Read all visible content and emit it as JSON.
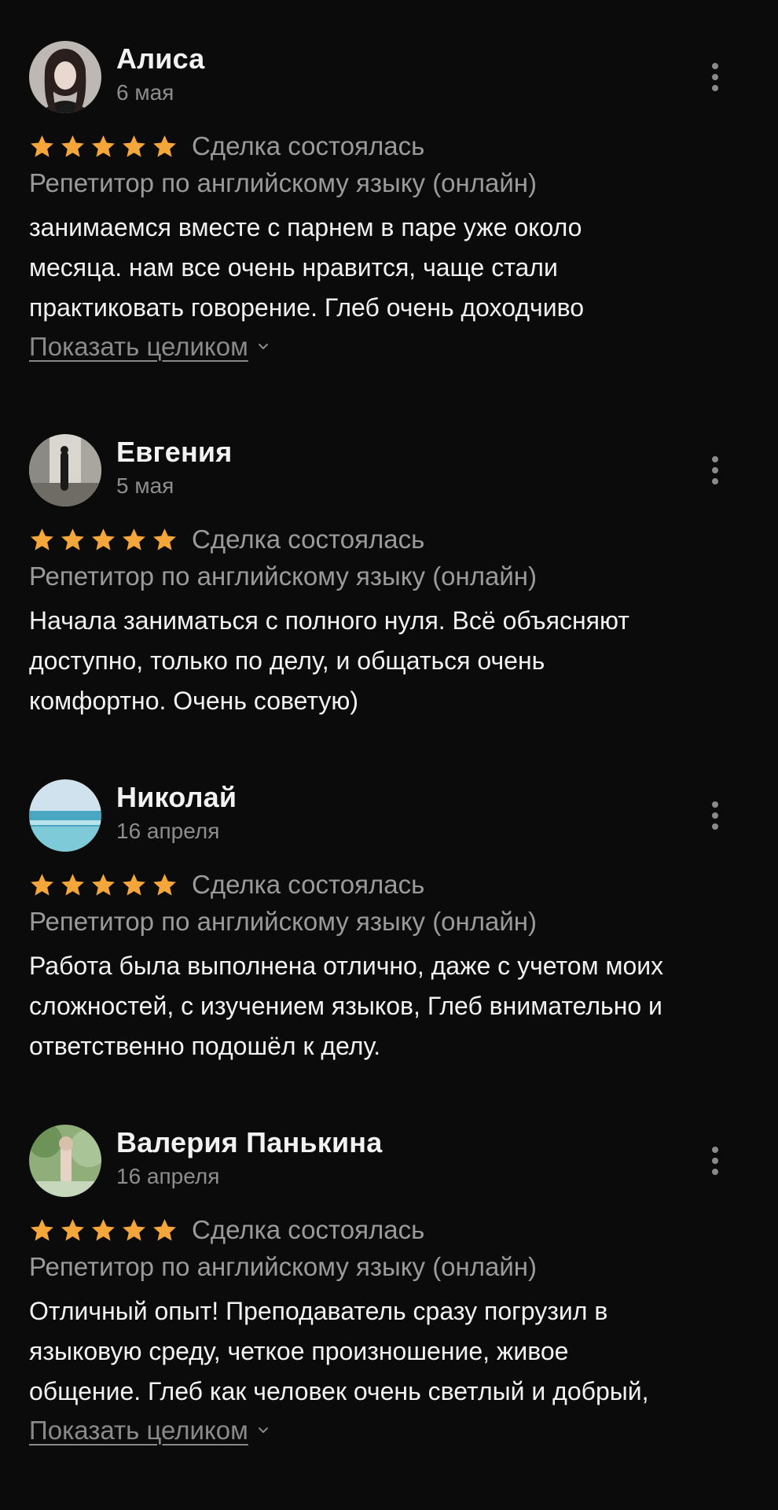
{
  "colors": {
    "background": "#0b0b0b",
    "star": "#f4a63a",
    "muted_text": "#9a9a9a",
    "primary_text": "#f2f2f2"
  },
  "icons": {
    "star": "star-icon",
    "menu": "more-vertical-icon",
    "expand": "chevron-down-icon"
  },
  "reviews": [
    {
      "author": "Алиса",
      "date": "6 мая",
      "rating": 5,
      "status": "Сделка состоялась",
      "service": "Репетитор по английскому языку (онлайн)",
      "text_lines": [
        "занимаемся вместе с парнем в паре уже около",
        "месяца. нам все очень нравится, чаще стали",
        "практиковать говорение. Глеб очень доходчиво"
      ],
      "show_more": "Показать целиком"
    },
    {
      "author": "Евгения",
      "date": "5 мая",
      "rating": 5,
      "status": "Сделка состоялась",
      "service": "Репетитор по английскому языку (онлайн)",
      "text_lines": [
        "Начала заниматься с полного нуля. Всё объясняют",
        "доступно, только по делу, и общаться очень",
        "комфортно. Очень советую)"
      ]
    },
    {
      "author": "Николай",
      "date": "16 апреля",
      "rating": 5,
      "status": "Сделка состоялась",
      "service": "Репетитор по английскому языку (онлайн)",
      "text_lines": [
        "Работа была выполнена отлично, даже с учетом моих",
        "сложностей, с изучением языков, Глеб внимательно и",
        "ответственно подошёл к делу."
      ]
    },
    {
      "author": "Валерия Панькина",
      "date": "16 апреля",
      "rating": 5,
      "status": "Сделка состоялась",
      "service": "Репетитор по английскому языку (онлайн)",
      "text_lines": [
        "Отличный опыт! Преподаватель сразу погрузил в",
        "языковую среду, четкое произношение, живое",
        "общение.  Глеб как человек очень светлый и добрый,"
      ],
      "show_more": "Показать целиком"
    }
  ]
}
